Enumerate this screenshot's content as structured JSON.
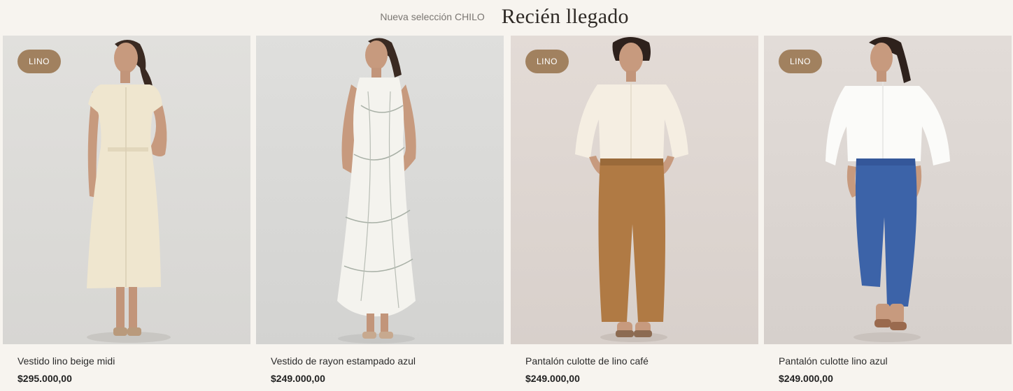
{
  "header": {
    "subtitle": "Nueva selección CHILO",
    "title": "Recién llegado"
  },
  "colors": {
    "background": "#f7f4ef",
    "badge": "#a1815f"
  },
  "products": [
    {
      "badge": "LINO",
      "name": "Vestido lino beige midi",
      "price": "$295.000,00",
      "image": "model-beige-linen-midi-dress"
    },
    {
      "badge": "",
      "name": "Vestido de rayon estampado azul",
      "price": "$249.000,00",
      "image": "model-printed-rayon-dress"
    },
    {
      "badge": "LINO",
      "name": "Pantalón culotte de lino café",
      "price": "$249.000,00",
      "image": "model-brown-linen-culotte"
    },
    {
      "badge": "LINO",
      "name": "Pantalón culotte lino azul",
      "price": "$249.000,00",
      "image": "model-blue-linen-culotte"
    }
  ]
}
